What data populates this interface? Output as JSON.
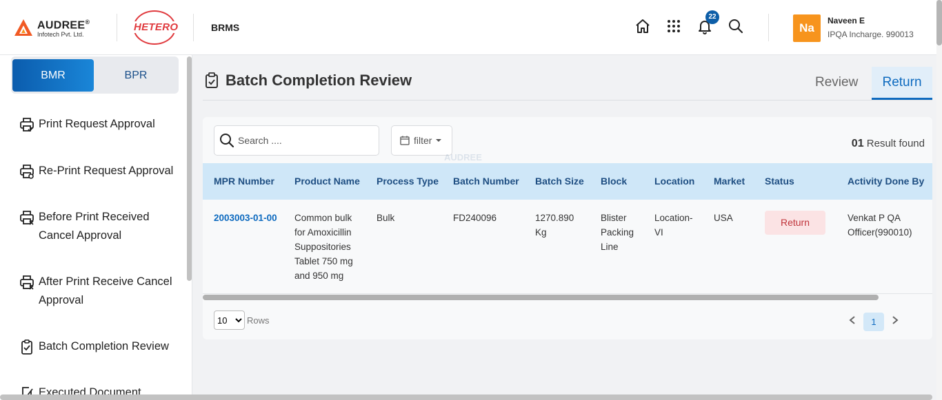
{
  "header": {
    "logo_name": "AUDREE",
    "logo_reg": "®",
    "logo_sub": "Infotech Pvt. Ltd.",
    "client_logo": "HETERO",
    "app_name": "BRMS",
    "notification_count": "22",
    "user": {
      "initials": "Na",
      "name": "Naveen E",
      "role": "IPQA Incharge. 990013"
    },
    "icons": [
      "home-icon",
      "apps-grid-icon",
      "bell-icon",
      "search-icon"
    ]
  },
  "sidebar": {
    "segments": [
      {
        "label": "BMR",
        "active": true
      },
      {
        "label": "BPR",
        "active": false
      }
    ],
    "items": [
      {
        "label": "Print Request Approval",
        "icon": "printer-check-icon"
      },
      {
        "label": "Re-Print Request Approval",
        "icon": "printer-refresh-icon"
      },
      {
        "label": "Before Print Received Cancel Approval",
        "icon": "printer-cancel-icon"
      },
      {
        "label": "After Print Receive Cancel Approval",
        "icon": "printer-cancel-icon"
      },
      {
        "label": "Batch Completion Review",
        "icon": "clipboard-check-icon"
      },
      {
        "label": "Executed Document",
        "icon": "document-edit-icon"
      }
    ]
  },
  "main": {
    "title": "Batch Completion Review",
    "tabs": [
      {
        "label": "Review",
        "active": false
      },
      {
        "label": "Return",
        "active": true
      }
    ],
    "search_placeholder": "Search ....",
    "filter_label": "filter",
    "result_count": "01",
    "result_text": "Result found",
    "columns": [
      "MPR Number",
      "Product Name",
      "Process Type",
      "Batch Number",
      "Batch Size",
      "Block",
      "Location",
      "Market",
      "Status",
      "Activity Done By"
    ],
    "rows": [
      {
        "mpr": "2003003-01-00",
        "product_name": "Common bulk for Amoxicillin Suppositories Tablet 750 mg and 950 mg",
        "process_type": "Bulk",
        "batch_number": "FD240096",
        "batch_size": "1270.890 Kg",
        "block": "Blister Packing Line",
        "location": "Location-VI",
        "market": "USA",
        "status": "Return",
        "activity_done_by": "Venkat P QA Officer(990010)"
      }
    ],
    "rows_per_page": "10",
    "rows_label": "Rows",
    "current_page": "1",
    "watermark": "AUDREE"
  },
  "colors": {
    "primary": "#0d6abf",
    "header_row": "#cfe7f8",
    "status_return_bg": "#fbe3e4",
    "status_return_text": "#c0343b",
    "avatar": "#f7941d",
    "brand_red": "#e03a3e"
  }
}
